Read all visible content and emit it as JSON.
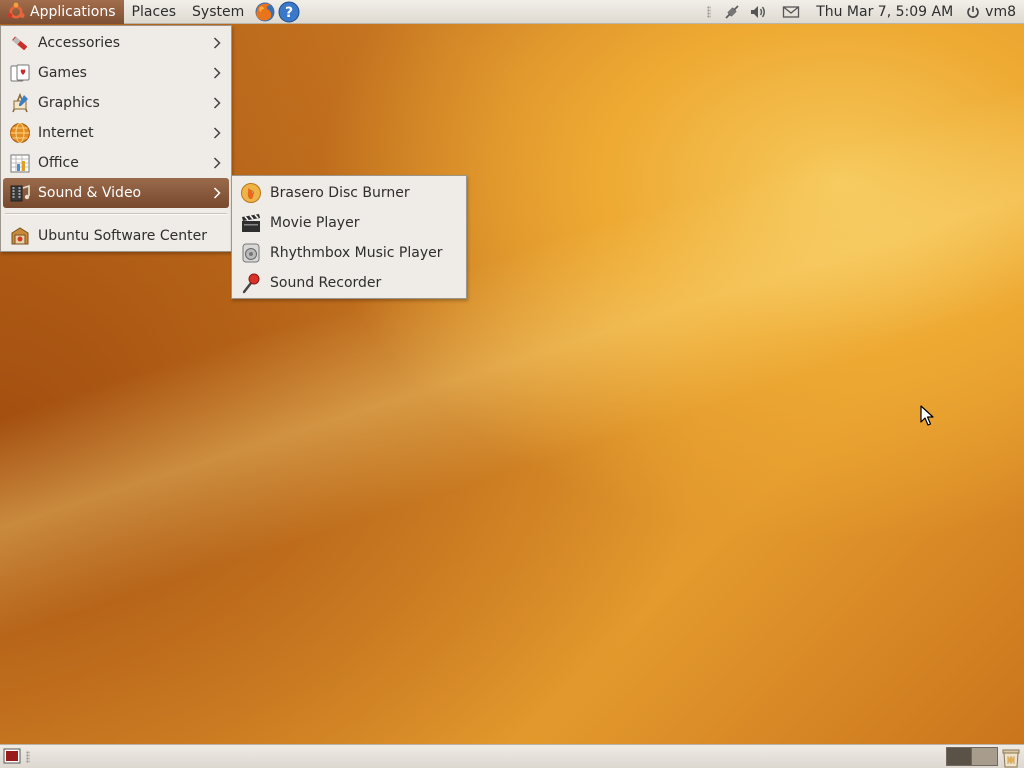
{
  "top_panel": {
    "menus": {
      "applications": "Applications",
      "places": "Places",
      "system": "System"
    },
    "launchers": [
      "firefox-icon",
      "help-icon"
    ],
    "tray": [
      "network-icon",
      "volume-icon",
      "mail-icon"
    ],
    "clock": "Thu Mar  7,  5:09 AM",
    "user": "vm8"
  },
  "applications_menu": {
    "items": [
      {
        "label": "Accessories",
        "icon": "accessories-icon",
        "has_submenu": true
      },
      {
        "label": "Games",
        "icon": "games-icon",
        "has_submenu": true
      },
      {
        "label": "Graphics",
        "icon": "graphics-icon",
        "has_submenu": true
      },
      {
        "label": "Internet",
        "icon": "internet-icon",
        "has_submenu": true
      },
      {
        "label": "Office",
        "icon": "office-icon",
        "has_submenu": true
      },
      {
        "label": "Sound & Video",
        "icon": "sound-video-icon",
        "has_submenu": true,
        "highlighted": true
      }
    ],
    "footer_item": {
      "label": "Ubuntu Software Center",
      "icon": "software-center-icon"
    }
  },
  "sound_video_submenu": {
    "items": [
      {
        "label": "Brasero Disc Burner",
        "icon": "brasero-icon"
      },
      {
        "label": "Movie Player",
        "icon": "movie-player-icon"
      },
      {
        "label": "Rhythmbox Music Player",
        "icon": "rhythmbox-icon"
      },
      {
        "label": "Sound Recorder",
        "icon": "microphone-icon"
      }
    ]
  },
  "bottom_panel": {
    "workspaces": 2,
    "current_workspace": 1
  },
  "colors": {
    "menu_highlight": "#8a5b3e",
    "panel": "#e6e2db",
    "desktop": "#dd9028"
  }
}
